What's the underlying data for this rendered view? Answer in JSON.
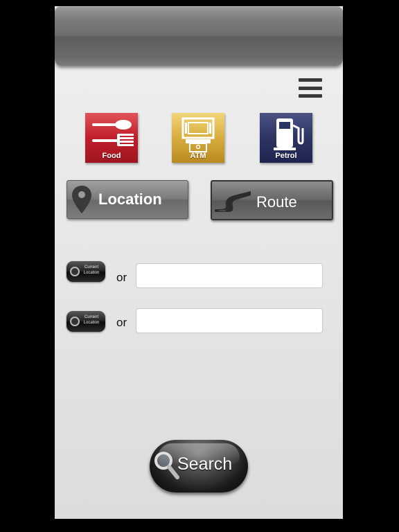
{
  "categories": [
    {
      "label": "Food",
      "icon": "fork-spoon-icon",
      "color": "#c01e2a"
    },
    {
      "label": "ATM",
      "icon": "atm-icon",
      "color": "#d7ad3e"
    },
    {
      "label": "Petrol",
      "icon": "fuel-pump-icon",
      "color": "#2c3462"
    }
  ],
  "modes": {
    "location_label": "Location",
    "route_label": "Route"
  },
  "inputs": {
    "from": {
      "current_location_label": "Current Location",
      "or_label": "or",
      "value": "",
      "placeholder": ""
    },
    "to": {
      "current_location_label": "Current Location",
      "or_label": "or",
      "value": "",
      "placeholder": ""
    }
  },
  "search": {
    "label": "Search",
    "icon": "magnifier-icon"
  },
  "menu": {
    "icon": "hamburger-menu-icon"
  }
}
